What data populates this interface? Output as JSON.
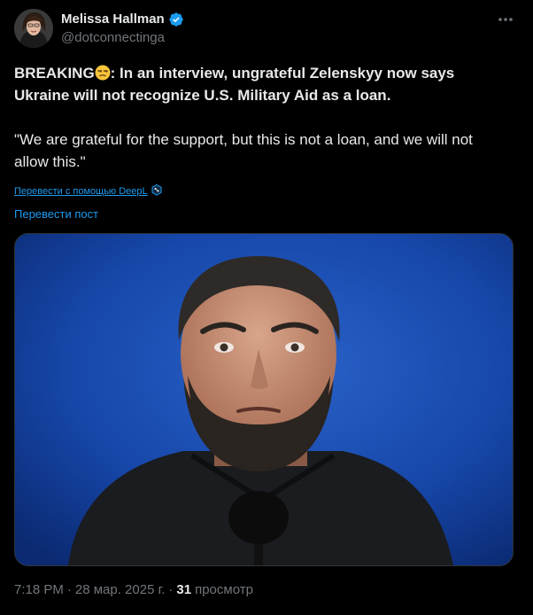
{
  "author": {
    "display_name": "Melissa Hallman",
    "handle": "@dotconnectinga",
    "verified": true,
    "verified_color": "#1d9bf0"
  },
  "tweet": {
    "breaking_label": "BREAKING",
    "headline": ": In an interview, ungrateful Zelenskyy now says Ukraine will not recognize U.S. Military Aid as a loan.",
    "quote": "\"We are grateful for the support, but this is not a loan, and we will not allow this.\"",
    "emoji": "unamused-face-emoji"
  },
  "translation": {
    "deepl_label": "Перевести с помощью DeepL",
    "translate_post_label": "Перевести пост"
  },
  "media": {
    "icon": "photo-man-at-microphone"
  },
  "meta": {
    "time": "7:18 PM",
    "separator": "·",
    "date": "28 мар. 2025 г.",
    "separator2": "·",
    "views_count": "31",
    "views_label": "просмотр"
  },
  "colors": {
    "background": "#000000",
    "text": "#e7e9ea",
    "secondary": "#71767b",
    "link": "#1d9bf0"
  }
}
